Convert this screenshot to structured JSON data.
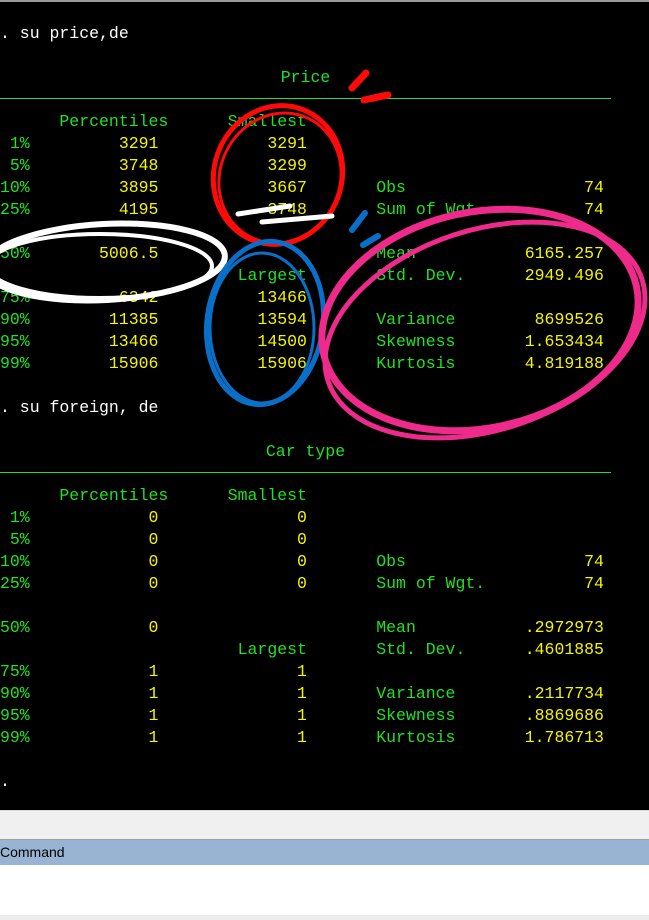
{
  "results": {
    "blocks": [
      {
        "command": ". su price,de",
        "title": "Price",
        "headers": {
          "percentiles": "Percentiles",
          "smallest": "Smallest",
          "largest": "Largest"
        },
        "rows": [
          {
            "p": "1%",
            "pv": "3291",
            "sv": "3291",
            "sl": "",
            "svv": ""
          },
          {
            "p": "5%",
            "pv": "3748",
            "sv": "3299",
            "sl": "",
            "svv": ""
          },
          {
            "p": "10%",
            "pv": "3895",
            "sv": "3667",
            "sl": "Obs",
            "svv": "74"
          },
          {
            "p": "25%",
            "pv": "4195",
            "sv": "3748",
            "sl": "Sum of Wgt.",
            "svv": "74"
          },
          {
            "p": "50%",
            "pv": "5006.5",
            "sv": "",
            "sl": "Mean",
            "svv": "6165.257"
          },
          {
            "p": "",
            "pv": "",
            "sv": "Largest",
            "sl": "Std. Dev.",
            "svv": "2949.496"
          },
          {
            "p": "75%",
            "pv": "6342",
            "sv": "13466",
            "sl": "",
            "svv": ""
          },
          {
            "p": "90%",
            "pv": "11385",
            "sv": "13594",
            "sl": "Variance",
            "svv": "8699526"
          },
          {
            "p": "95%",
            "pv": "13466",
            "sv": "14500",
            "sl": "Skewness",
            "svv": "1.653434"
          },
          {
            "p": "99%",
            "pv": "15906",
            "sv": "15906",
            "sl": "Kurtosis",
            "svv": "4.819188"
          }
        ]
      },
      {
        "command": ". su foreign, de",
        "title": "Car type",
        "headers": {
          "percentiles": "Percentiles",
          "smallest": "Smallest",
          "largest": "Largest"
        },
        "rows": [
          {
            "p": "1%",
            "pv": "0",
            "sv": "0",
            "sl": "",
            "svv": ""
          },
          {
            "p": "5%",
            "pv": "0",
            "sv": "0",
            "sl": "",
            "svv": ""
          },
          {
            "p": "10%",
            "pv": "0",
            "sv": "0",
            "sl": "Obs",
            "svv": "74"
          },
          {
            "p": "25%",
            "pv": "0",
            "sv": "0",
            "sl": "Sum of Wgt.",
            "svv": "74"
          },
          {
            "p": "50%",
            "pv": "0",
            "sv": "",
            "sl": "Mean",
            "svv": ".2972973"
          },
          {
            "p": "",
            "pv": "",
            "sv": "Largest",
            "sl": "Std. Dev.",
            "svv": ".4601885"
          },
          {
            "p": "75%",
            "pv": "1",
            "sv": "1",
            "sl": "",
            "svv": ""
          },
          {
            "p": "90%",
            "pv": "1",
            "sv": "1",
            "sl": "Variance",
            "svv": ".2117734"
          },
          {
            "p": "95%",
            "pv": "1",
            "sv": "1",
            "sl": "Skewness",
            "svv": ".8869686"
          },
          {
            "p": "99%",
            "pv": "1",
            "sv": "1",
            "sl": "Kurtosis",
            "svv": "1.786713"
          }
        ]
      }
    ],
    "prompt": "."
  },
  "command_panel": {
    "label": "Command",
    "value": ""
  },
  "annotation_colors": {
    "red": "#ff0a0a",
    "white": "#ffffff",
    "blue": "#0a6fc8",
    "pink": "#ee2a8a"
  }
}
